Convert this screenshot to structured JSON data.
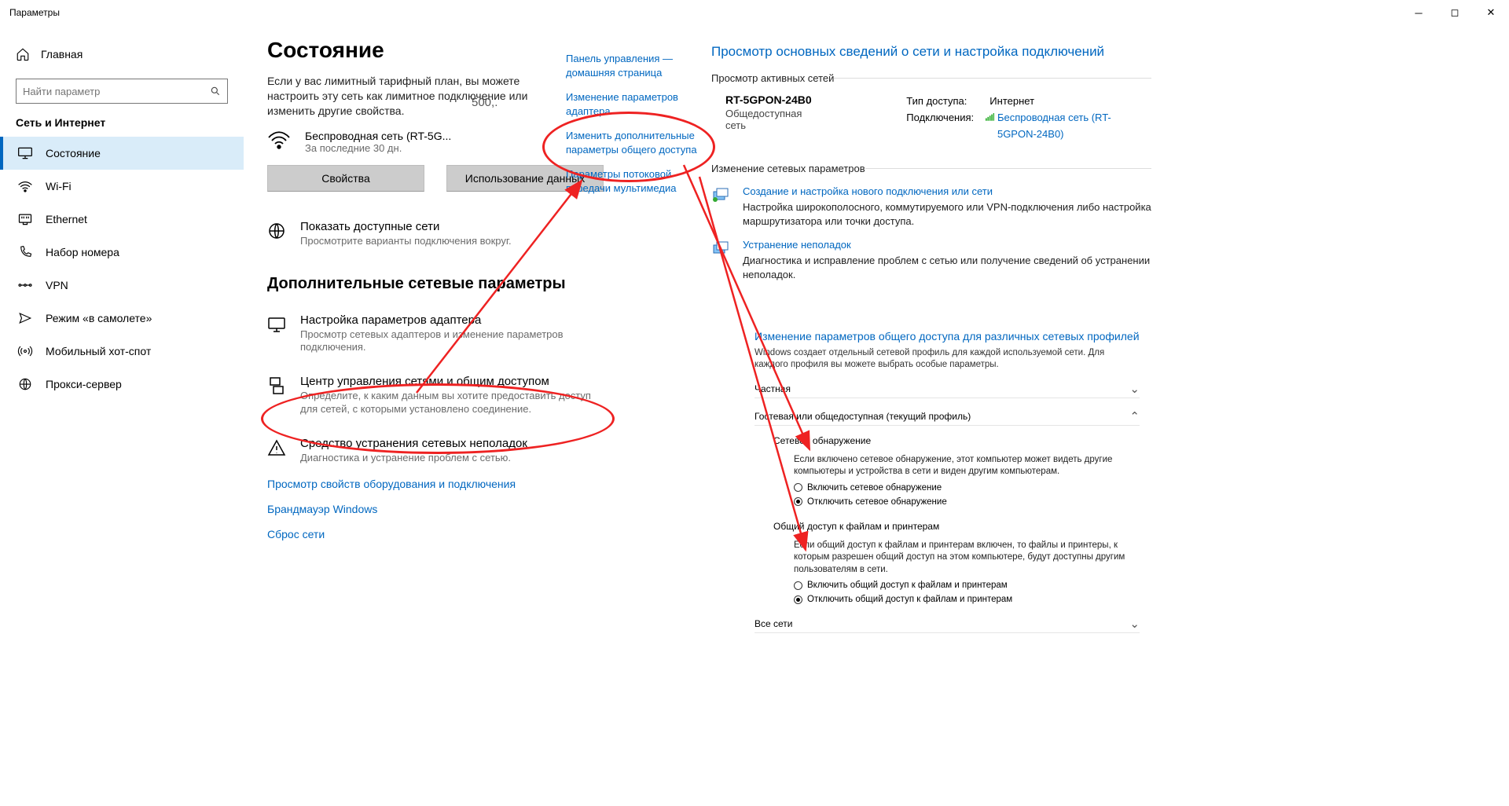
{
  "win": {
    "title": "Параметры"
  },
  "sidebar": {
    "home": "Главная",
    "search_placeholder": "Найти параметр",
    "category": "Сеть и Интернет",
    "items": [
      {
        "label": "Состояние",
        "icon": "status"
      },
      {
        "label": "Wi-Fi",
        "icon": "wifi"
      },
      {
        "label": "Ethernet",
        "icon": "ethernet"
      },
      {
        "label": "Набор номера",
        "icon": "dial"
      },
      {
        "label": "VPN",
        "icon": "vpn"
      },
      {
        "label": "Режим «в самолете»",
        "icon": "airplane"
      },
      {
        "label": "Мобильный хот-спот",
        "icon": "hotspot"
      },
      {
        "label": "Прокси-сервер",
        "icon": "proxy"
      }
    ]
  },
  "main": {
    "h1": "Состояние",
    "para": "Если у вас лимитный тарифный план, вы можете настроить эту сеть как лимитное подключение или изменить другие свойства.",
    "net_name": "Беспроводная сеть (RT-5G...",
    "net_sub": "За последние 30 дн.",
    "speed": "500,.",
    "btn_props": "Свойства",
    "btn_usage": "Использование данных",
    "show_networks_t": "Показать доступные сети",
    "show_networks_s": "Просмотрите варианты подключения вокруг.",
    "h2": "Дополнительные сетевые параметры",
    "adapter_t": "Настройка параметров адаптера",
    "adapter_s": "Просмотр сетевых адаптеров и изменение параметров подключения.",
    "center_t": "Центр управления сетями и общим доступом",
    "center_s": "Определите, к каким данным вы хотите предоставить доступ для сетей, с которыми установлено соединение.",
    "troubleshoot_t": "Средство устранения сетевых неполадок",
    "troubleshoot_s": "Диагностика и устранение проблем с сетью.",
    "link_hw": "Просмотр свойств оборудования и подключения",
    "link_fw": "Брандмауэр Windows",
    "link_reset": "Сброс сети"
  },
  "cp": {
    "home": "Панель управления — домашняя страница",
    "adapter": "Изменение параметров адаптера",
    "sharing": "Изменить дополнительные параметры общего доступа",
    "media": "Параметры потоковой передачи мультимедиа"
  },
  "nc": {
    "title": "Просмотр основных сведений о сети и настройка подключений",
    "active_label": "Просмотр активных сетей",
    "net_name": "RT-5GPON-24B0",
    "net_type": "Общедоступная сеть",
    "access_label": "Тип доступа:",
    "access_value": "Интернет",
    "conn_label": "Подключения:",
    "conn_value": "Беспроводная сеть (RT-5GPON-24B0)",
    "change_label": "Изменение сетевых параметров",
    "setup_t": "Создание и настройка нового подключения или сети",
    "setup_s": "Настройка широкополосного, коммутируемого или VPN-подключения либо настройка маршрутизатора или точки доступа.",
    "trouble_t": "Устранение неполадок",
    "trouble_s": "Диагностика и исправление проблем с сетью или получение сведений об устранении неполадок."
  },
  "sh": {
    "title": "Изменение параметров общего доступа для различных сетевых профилей",
    "desc": "Windows создает отдельный сетевой профиль для каждой используемой сети. Для каждого профиля вы можете выбрать особые параметры.",
    "private": "Частная",
    "guest": "Гостевая или общедоступная (текущий профиль)",
    "discovery_h": "Сетевое обнаружение",
    "discovery_p": "Если включено сетевое обнаружение, этот компьютер может видеть другие компьютеры и устройства в сети и виден другим компьютерам.",
    "discovery_on": "Включить сетевое обнаружение",
    "discovery_off": "Отключить сетевое обнаружение",
    "files_h": "Общий доступ к файлам и принтерам",
    "files_p": "Если общий доступ к файлам и принтерам включен, то файлы и принтеры, к которым разрешен общий доступ на этом компьютере, будут доступны другим пользователям в сети.",
    "files_on": "Включить общий доступ к файлам и принтерам",
    "files_off": "Отключить общий доступ к файлам и принтерам",
    "all": "Все сети"
  }
}
